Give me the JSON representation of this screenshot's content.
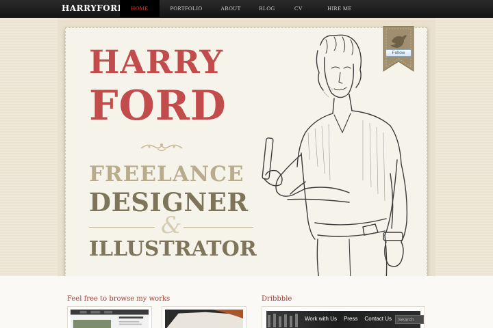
{
  "logo": "HARRYFORD",
  "nav": [
    "HOME",
    "PORTFOLIO",
    "ABOUT",
    "BLOG",
    "CV",
    "HIRE ME"
  ],
  "active_nav": "HOME",
  "hero": {
    "name_line1": "HARRY",
    "name_line2": "FORD",
    "tagline_line1": "FREELANCE",
    "tagline_line2": "DESIGNER",
    "ampersand": "&",
    "tagline_line3": "ILLUSTRATOR"
  },
  "twitter": {
    "follow_label": "Follow"
  },
  "works": {
    "title": "Feel free to browse my works"
  },
  "dribbble": {
    "title": "Dribbble",
    "links": [
      "Work with Us",
      "Press",
      "Contact Us"
    ],
    "search_placeholder": "Search"
  },
  "colors": {
    "accent_red": "#c24b4b",
    "nav_active": "#d33a2c",
    "tan_light": "#b9ac8c",
    "tan_dark": "#7e7459"
  }
}
